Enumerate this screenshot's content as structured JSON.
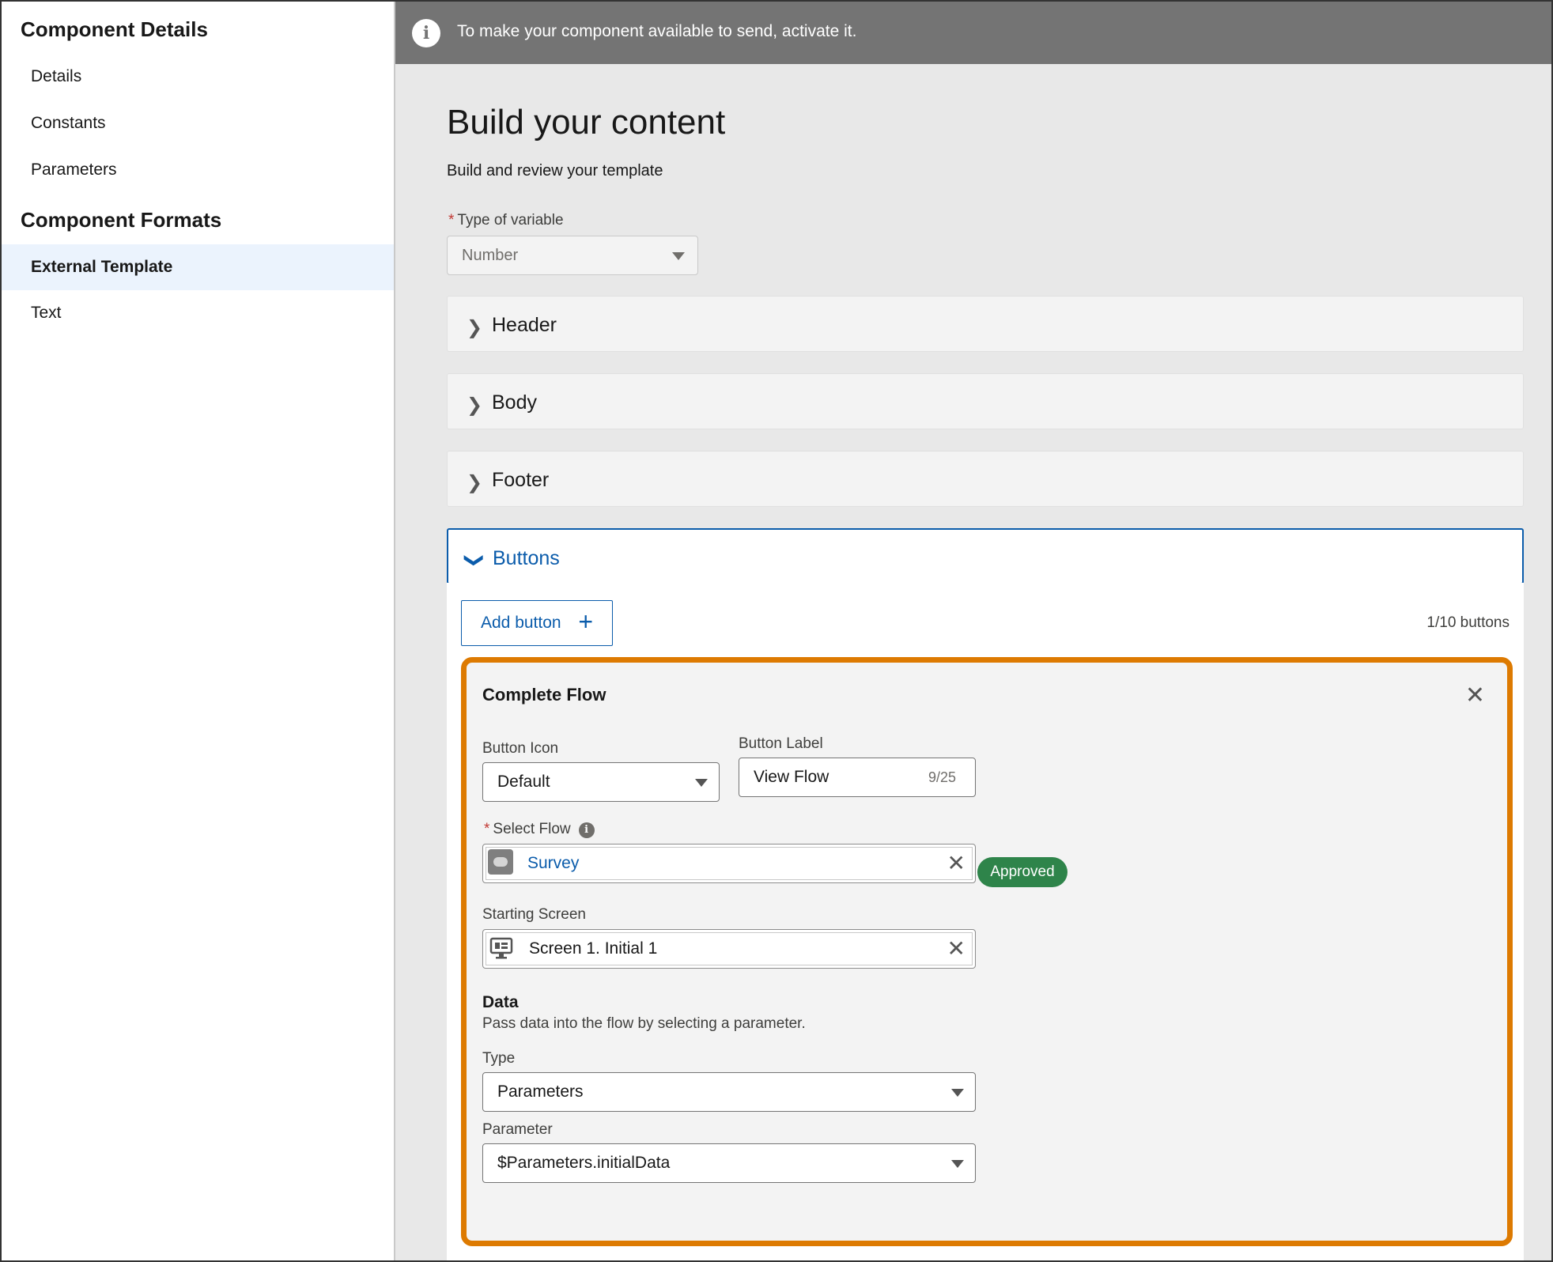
{
  "sidebar": {
    "heading_details": "Component Details",
    "details_items": [
      "Details",
      "Constants",
      "Parameters"
    ],
    "heading_formats": "Component Formats",
    "format_items": [
      "External Template",
      "Text"
    ],
    "active_item": "External Template"
  },
  "banner": {
    "icon": "info-icon",
    "text": "To make your component available to send, activate it."
  },
  "content": {
    "title": "Build your content",
    "subtitle": "Build and review your template",
    "variable_type": {
      "label": "Type of variable",
      "value": "Number"
    },
    "sections": [
      "Header",
      "Body",
      "Footer",
      "Buttons"
    ],
    "open_section": "Buttons",
    "add_button_label": "Add button",
    "button_count": "1/10 buttons"
  },
  "button_card": {
    "title": "Complete Flow",
    "icon_label": "Button Icon",
    "icon_value": "Default",
    "label_label": "Button Label",
    "label_value": "View Flow",
    "label_count": "9/25",
    "select_flow_label": "Select Flow",
    "flow_value": "Survey",
    "flow_status": "Approved",
    "starting_screen_label": "Starting Screen",
    "starting_screen_value": "Screen 1. Initial 1",
    "data_title": "Data",
    "data_desc": "Pass data into the flow by selecting a parameter.",
    "type_label": "Type",
    "type_value": "Parameters",
    "parameter_label": "Parameter",
    "parameter_value": "$Parameters.initialData"
  },
  "colors": {
    "brand_blue": "#0b5cab",
    "highlight_orange": "#dd7a01",
    "approved_green": "#2e844a",
    "banner_gray": "#747474"
  }
}
